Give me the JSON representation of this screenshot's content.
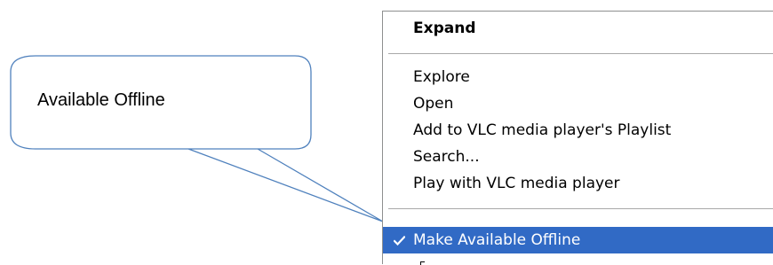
{
  "callout": {
    "text": "Available Offline"
  },
  "menu": {
    "items": [
      {
        "label": "Expand",
        "bold": true
      },
      {
        "label": "Explore"
      },
      {
        "label": "Open"
      },
      {
        "label": "Add to VLC media player's Playlist"
      },
      {
        "label": "Search..."
      },
      {
        "label": "Play with VLC media player"
      },
      {
        "label": "Make Available Offline",
        "checked": true,
        "selected": true
      }
    ]
  },
  "colors": {
    "selection_bg": "#316ac5",
    "selection_fg": "#ffffff",
    "callout_stroke": "#4f81bd",
    "menu_border": "#8e8f8f"
  },
  "icons": {
    "check": "check-icon"
  }
}
